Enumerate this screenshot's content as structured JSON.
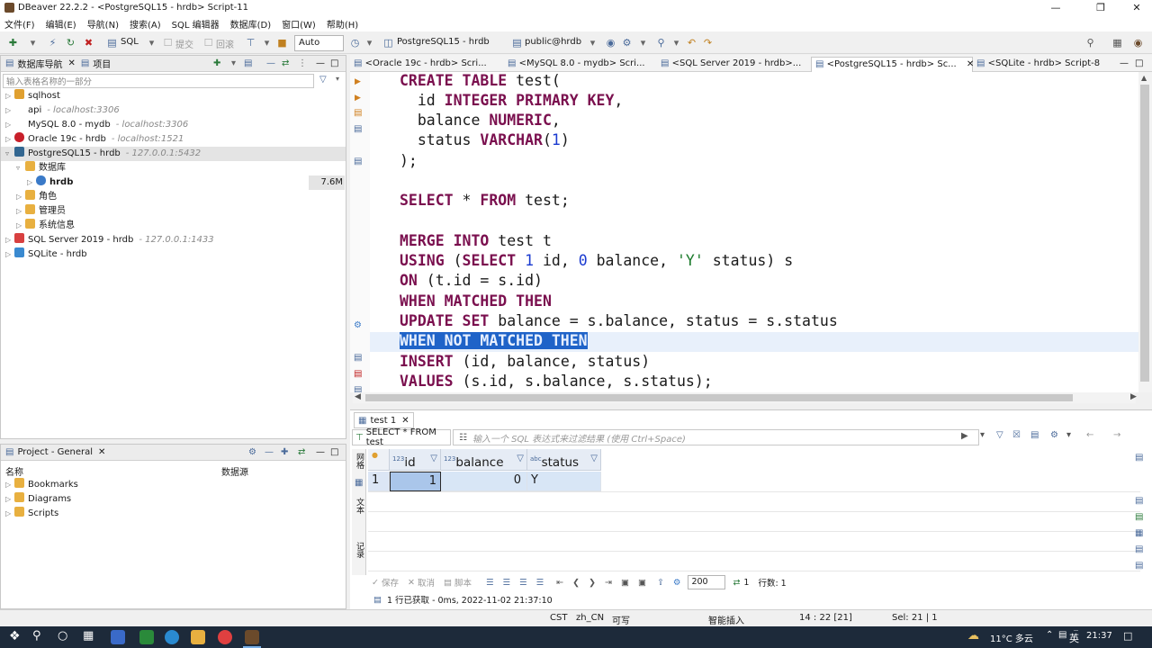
{
  "window": {
    "title": "DBeaver 22.2.2 - <PostgreSQL15 - hrdb> Script-11"
  },
  "menu": [
    "文件(F)",
    "编辑(E)",
    "导航(N)",
    "搜索(A)",
    "SQL 编辑器",
    "数据库(D)",
    "窗口(W)",
    "帮助(H)"
  ],
  "toolbar": {
    "sql_label": "SQL",
    "commit_label": "提交",
    "rollback_label": "回滚",
    "transaction_mode": "Auto",
    "connection": "PostgreSQL15 - hrdb",
    "schema": "public@hrdb"
  },
  "navigator": {
    "tab_label": "数据库导航",
    "project_tab_label": "项目",
    "filter_placeholder": "输入表格名称的一部分",
    "items": [
      {
        "label": "sqlhost",
        "host": ""
      },
      {
        "label": "api",
        "host": "- localhost:3306"
      },
      {
        "label": "MySQL 8.0 - mydb",
        "host": "- localhost:3306"
      },
      {
        "label": "Oracle 19c - hrdb",
        "host": "- localhost:1521"
      },
      {
        "label": "PostgreSQL15 - hrdb",
        "host": "- 127.0.0.1:5432"
      },
      {
        "label": "数据库",
        "host": ""
      },
      {
        "label": "hrdb",
        "host": "",
        "size": "7.6M"
      },
      {
        "label": "角色",
        "host": ""
      },
      {
        "label": "管理员",
        "host": ""
      },
      {
        "label": "系统信息",
        "host": ""
      },
      {
        "label": "SQL Server 2019 - hrdb",
        "host": "- 127.0.0.1:1433"
      },
      {
        "label": "SQLite - hrdb",
        "host": ""
      }
    ]
  },
  "project": {
    "tab_label": "Project - General",
    "col_name": "名称",
    "col_datasource": "数据源",
    "items": [
      "Bookmarks",
      "Diagrams",
      "Scripts"
    ]
  },
  "editor_tabs": [
    "<Oracle 19c - hrdb> Scri...",
    "<MySQL 8.0 - mydb> Scri...",
    "<SQL Server 2019 - hrdb>...",
    "<PostgreSQL15 - hrdb> Sc...",
    "<SQLite - hrdb> Script-8"
  ],
  "results": {
    "tab_label": "test 1",
    "query_label": "SELECT * FROM test",
    "filter_placeholder": "输入一个 SQL 表达式来过滤结果 (使用 Ctrl+Space)",
    "side_labels": [
      "网格",
      "文本",
      "记录"
    ],
    "columns": [
      "id",
      "balance",
      "status"
    ],
    "row_number": "1",
    "row": [
      "1",
      "0",
      "Y"
    ],
    "footer": {
      "save": "保存",
      "cancel": "取消",
      "script": "脚本",
      "fetch_size": "200",
      "row_count_value": "1",
      "row_count_label": "行数: 1"
    },
    "fetch_status": "1 行已获取 - 0ms, 2022-11-02 21:37:10"
  },
  "statusbar": {
    "tz": "CST",
    "locale": "zh_CN",
    "mode": "可写",
    "insert": "智能插入",
    "position": "14 : 22 [21]",
    "selection": "Sel: 21 | 1"
  },
  "taskbar": {
    "weather": "11°C  多云",
    "ime": "英",
    "time": "21:37"
  }
}
